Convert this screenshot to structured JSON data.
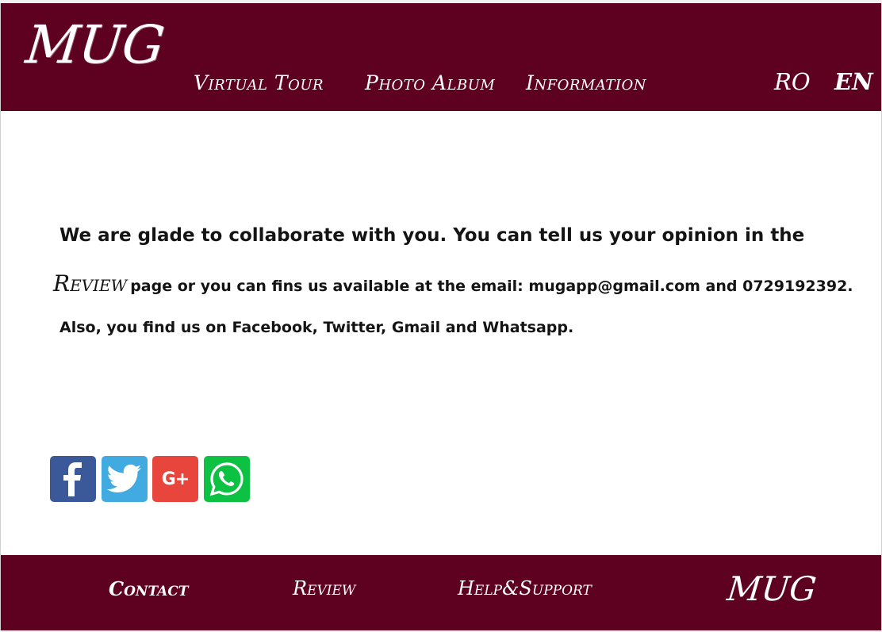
{
  "header": {
    "logo": "MUG",
    "nav": [
      {
        "label": "Virtual Tour"
      },
      {
        "label": "Photo Album"
      },
      {
        "label": "Information"
      }
    ],
    "languages": [
      {
        "label": "RO",
        "active": false
      },
      {
        "label": "EN",
        "active": true
      }
    ]
  },
  "main": {
    "line1": "We are glade to collaborate with you. You can tell us your opinion in the",
    "review_link": "Review",
    "line2_rest": "page or you can fins us available at the email: mugapp@gmail.com and 0729192392.",
    "line3": "Also, you find us on Facebook, Twitter, Gmail and Whatsapp.",
    "social": [
      {
        "name": "Facebook",
        "icon": "facebook-icon",
        "color": "#3b5998"
      },
      {
        "name": "Twitter",
        "icon": "twitter-icon",
        "color": "#41abe1"
      },
      {
        "name": "Google+",
        "icon": "google-plus-icon",
        "color": "#e8453c",
        "glyph": "G+"
      },
      {
        "name": "WhatsApp",
        "icon": "whatsapp-icon",
        "color": "#0dc143"
      }
    ]
  },
  "footer": {
    "links": [
      {
        "label": "Contact",
        "active": true
      },
      {
        "label": "Review",
        "active": false
      },
      {
        "label": "Help&Support",
        "active": false
      }
    ],
    "logo": "MUG"
  },
  "colors": {
    "brand": "#5e0120",
    "text": "#141414",
    "background": "#ffffff"
  }
}
